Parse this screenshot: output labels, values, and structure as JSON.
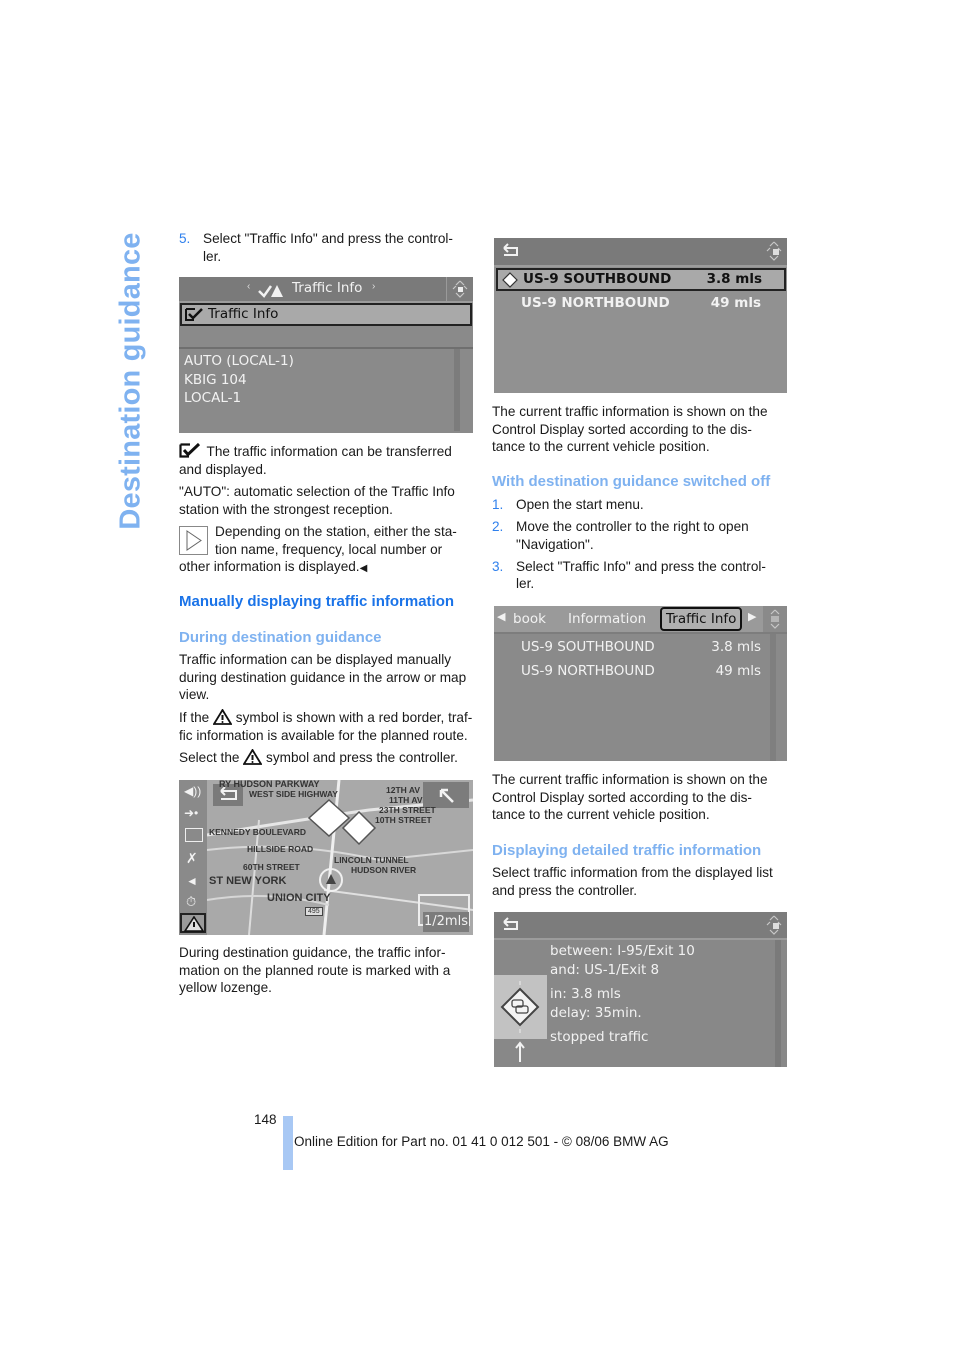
{
  "side_title": "Destination guidance",
  "left_column": {
    "step5": {
      "num": "5.",
      "text1": "Select \"Traffic Info\" and press the control-",
      "text2": "ler."
    },
    "screen1": {
      "header_title": "Traffic Info",
      "selected_item": "Traffic Info",
      "stations": [
        "AUTO (LOCAL-1)",
        "KBIG 104",
        "LOCAL-1"
      ]
    },
    "check_note": {
      "line1": "The traffic information can be transferred",
      "line2": "and displayed."
    },
    "auto_note": {
      "line1": "\"AUTO\": automatic selection of the Traffic Info",
      "line2": "station with the strongest reception."
    },
    "tip_note": {
      "line1": "Depending on the station, either the sta-",
      "line2": "tion name, frequency, local number or",
      "line3": "other information is displayed."
    },
    "heading_manual": "Manually displaying traffic information",
    "subheading_during": "During destination guidance",
    "during_text": {
      "line1": "Traffic information can be displayed manually",
      "line2": "during destination guidance in the arrow or map",
      "line3": "view."
    },
    "red_border_text": {
      "line1a": "If the",
      "line1b": "symbol is shown with a red border, traf-",
      "line2": "fic information is available for the planned route."
    },
    "select_symbol_text": {
      "a": "Select the",
      "b": "symbol and press the controller."
    },
    "map_screen": {
      "labels": [
        "RY HUDSON PARKWAY",
        "WEST SIDE HIGHWAY",
        "12TH AV",
        "11TH AV",
        "23TH STREET",
        "10TH STREET",
        "KENNEDY BOULEVARD",
        "HILLSIDE ROAD",
        "60TH STREET",
        "LINCOLN TUNNEL",
        "HUDSON RIVER",
        "ST NEW YORK",
        "UNION CITY",
        "495"
      ],
      "scale": "1/2mls"
    },
    "map_caption": {
      "line1": "During destination guidance, the traffic infor-",
      "line2": "mation on the planned route is marked with a",
      "line3": "yellow lozenge."
    }
  },
  "right_column": {
    "screen2": {
      "rows": [
        {
          "name": "US-9 SOUTHBOUND",
          "dist": "3.8 mls",
          "selected": true
        },
        {
          "name": "US-9 NORTHBOUND",
          "dist": "49 mls",
          "selected": false
        }
      ]
    },
    "caption1": {
      "line1": "The current traffic information is shown on the",
      "line2": "Control Display sorted according to the dis-",
      "line3": "tance to the current vehicle position."
    },
    "heading_off": "With destination guidance switched off",
    "steps": [
      {
        "num": "1.",
        "line1": "Open the start menu."
      },
      {
        "num": "2.",
        "line1": "Move the controller to the right to open",
        "line2": "\"Navigation\"."
      },
      {
        "num": "3.",
        "line1": "Select \"Traffic Info\" and press the control-",
        "line2": "ler."
      }
    ],
    "screen3": {
      "tabs": [
        "book",
        "Information",
        "Traffic Info"
      ],
      "rows": [
        {
          "name": "US-9 SOUTHBOUND",
          "dist": "3.8 mls"
        },
        {
          "name": "US-9 NORTHBOUND",
          "dist": "49 mls"
        }
      ]
    },
    "caption2": {
      "line1": "The current traffic information is shown on the",
      "line2": "Control Display sorted according to the dis-",
      "line3": "tance to the current vehicle position."
    },
    "heading_detail": "Displaying detailed traffic information",
    "detail_text": {
      "line1": "Select traffic information from the displayed list",
      "line2": "and press the controller."
    },
    "screen4": {
      "lines": [
        "between: I-95/Exit 10",
        "and: US-1/Exit 8",
        "in: 3.8 mls",
        "delay: 35min.",
        "stopped traffic"
      ]
    }
  },
  "footer": {
    "page_number": "148",
    "edition": "Online Edition for Part no. 01 41 0 012 501 - © 08/06 BMW AG"
  }
}
